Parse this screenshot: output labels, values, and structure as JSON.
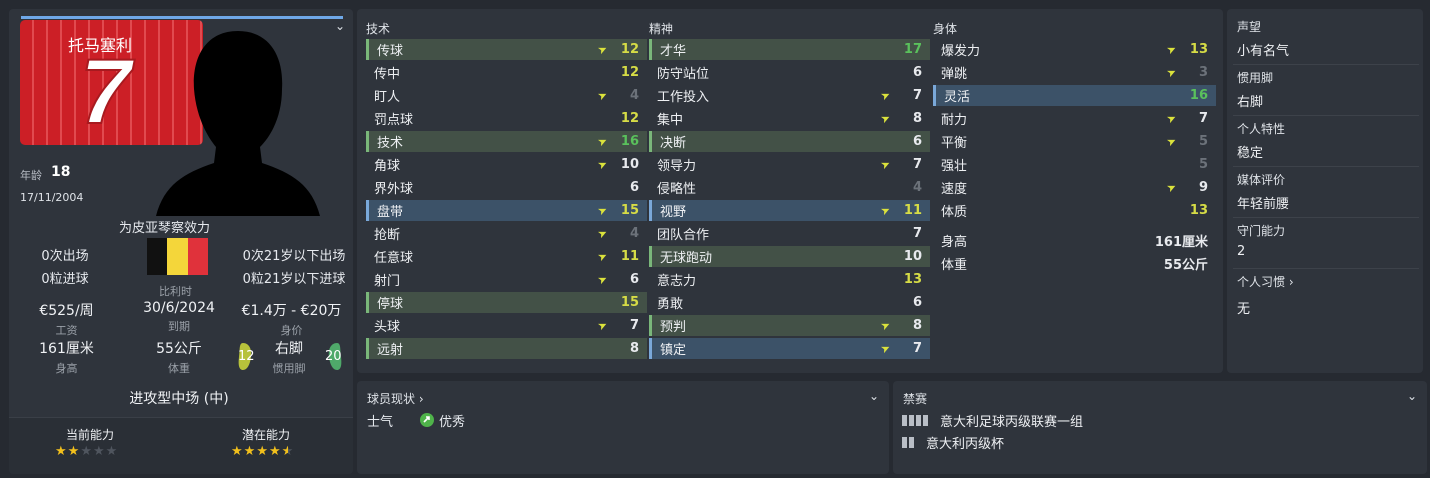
{
  "profile": {
    "shirt_name": "托马塞利",
    "shirt_number": "7",
    "age_label": "年龄",
    "age": "18",
    "dob": "17/11/2004",
    "club": "为皮亚琴察效力",
    "nation": "比利时",
    "apps": "0次出场",
    "goals": "0粒进球",
    "u21_apps": "0次21岁以下出场",
    "u21_goals": "0粒21岁以下进球",
    "wage": "€525/周",
    "wage_label": "工资",
    "expires": "30/6/2024",
    "expires_label": "到期",
    "value": "€1.4万 - €20万",
    "value_label": "身价",
    "height": "161厘米",
    "height_label": "身高",
    "weight": "55公斤",
    "weight_label": "体重",
    "left_foot": "12",
    "foot": "右脚",
    "foot_label": "惯用脚",
    "right_foot": "20",
    "role": "进攻型中场 (中)",
    "ca_label": "当前能力",
    "pa_label": "潜在能力",
    "ca_stars": 2,
    "pa_stars": 4.5
  },
  "attributes": {
    "technical_title": "技术",
    "mental_title": "精神",
    "physical_title": "身体",
    "technical": [
      {
        "name": "传球",
        "value": "12",
        "arrow": true,
        "hl": "green"
      },
      {
        "name": "传中",
        "value": "12",
        "arrow": false,
        "hl": ""
      },
      {
        "name": "盯人",
        "value": "4",
        "arrow": true,
        "hl": ""
      },
      {
        "name": "罚点球",
        "value": "12",
        "arrow": false,
        "hl": ""
      },
      {
        "name": "技术",
        "value": "16",
        "arrow": true,
        "hl": "green"
      },
      {
        "name": "角球",
        "value": "10",
        "arrow": true,
        "hl": ""
      },
      {
        "name": "界外球",
        "value": "6",
        "arrow": false,
        "hl": ""
      },
      {
        "name": "盘带",
        "value": "15",
        "arrow": true,
        "hl": "blue"
      },
      {
        "name": "抢断",
        "value": "4",
        "arrow": true,
        "hl": ""
      },
      {
        "name": "任意球",
        "value": "11",
        "arrow": true,
        "hl": ""
      },
      {
        "name": "射门",
        "value": "6",
        "arrow": true,
        "hl": ""
      },
      {
        "name": "停球",
        "value": "15",
        "arrow": false,
        "hl": "green"
      },
      {
        "name": "头球",
        "value": "7",
        "arrow": true,
        "hl": ""
      },
      {
        "name": "远射",
        "value": "8",
        "arrow": false,
        "hl": "green"
      }
    ],
    "mental": [
      {
        "name": "才华",
        "value": "17",
        "arrow": false,
        "hl": "green"
      },
      {
        "name": "防守站位",
        "value": "6",
        "arrow": false,
        "hl": ""
      },
      {
        "name": "工作投入",
        "value": "7",
        "arrow": true,
        "hl": ""
      },
      {
        "name": "集中",
        "value": "8",
        "arrow": true,
        "hl": ""
      },
      {
        "name": "决断",
        "value": "6",
        "arrow": false,
        "hl": "green"
      },
      {
        "name": "领导力",
        "value": "7",
        "arrow": true,
        "hl": ""
      },
      {
        "name": "侵略性",
        "value": "4",
        "arrow": false,
        "hl": ""
      },
      {
        "name": "视野",
        "value": "11",
        "arrow": true,
        "hl": "blue"
      },
      {
        "name": "团队合作",
        "value": "7",
        "arrow": false,
        "hl": ""
      },
      {
        "name": "无球跑动",
        "value": "10",
        "arrow": false,
        "hl": "green"
      },
      {
        "name": "意志力",
        "value": "13",
        "arrow": false,
        "hl": ""
      },
      {
        "name": "勇敢",
        "value": "6",
        "arrow": false,
        "hl": ""
      },
      {
        "name": "预判",
        "value": "8",
        "arrow": true,
        "hl": "green"
      },
      {
        "name": "镇定",
        "value": "7",
        "arrow": true,
        "hl": "blue"
      }
    ],
    "physical": [
      {
        "name": "爆发力",
        "value": "13",
        "arrow": true,
        "hl": ""
      },
      {
        "name": "弹跳",
        "value": "3",
        "arrow": true,
        "hl": ""
      },
      {
        "name": "灵活",
        "value": "16",
        "arrow": false,
        "hl": "blue"
      },
      {
        "name": "耐力",
        "value": "7",
        "arrow": true,
        "hl": ""
      },
      {
        "name": "平衡",
        "value": "5",
        "arrow": true,
        "hl": ""
      },
      {
        "name": "强壮",
        "value": "5",
        "arrow": false,
        "hl": ""
      },
      {
        "name": "速度",
        "value": "9",
        "arrow": true,
        "hl": ""
      },
      {
        "name": "体质",
        "value": "13",
        "arrow": false,
        "hl": ""
      }
    ],
    "height_label": "身高",
    "height": "161厘米",
    "weight_label": "体重",
    "weight": "55公斤"
  },
  "info": {
    "reputation_label": "声望",
    "reputation": "小有名气",
    "foot_label": "惯用脚",
    "foot": "右脚",
    "personality_label": "个人特性",
    "personality": "稳定",
    "media_label": "媒体评价",
    "media": "年轻前腰",
    "gk_label": "守门能力",
    "gk": "2",
    "habits_label": "个人习惯",
    "habits": "无"
  },
  "status": {
    "title": "球员现状",
    "morale_label": "士气",
    "morale": "优秀"
  },
  "bans": {
    "title": "禁赛",
    "items": [
      {
        "competition": "意大利足球丙级联赛一组",
        "bars": 4
      },
      {
        "competition": "意大利丙级杯",
        "bars": 2
      }
    ]
  }
}
